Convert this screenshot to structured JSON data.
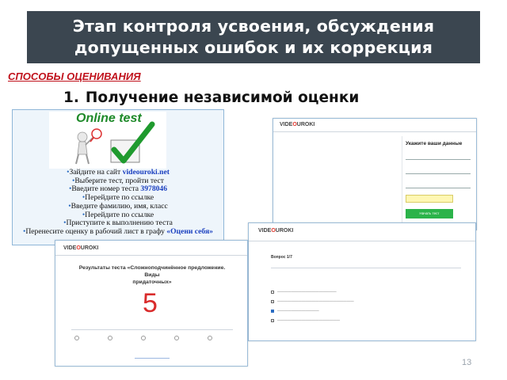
{
  "slide": {
    "title_line1": "Этап контроля усвоения, обсуждения",
    "title_line2": "допущенных ошибок  и их коррекция",
    "section_label": "СПОСОБЫ ОЦЕНИВАНИЯ",
    "list_number": "1.",
    "list_heading": "Получение независимой оценки",
    "page_number": "13"
  },
  "left_card": {
    "banner_text": "Online test",
    "steps": [
      {
        "text": "Зайдите на сайт ",
        "highlight": "videouroki.net"
      },
      {
        "text": "Выберите тест, пройти тест",
        "highlight": ""
      },
      {
        "text": "Введите номер теста ",
        "highlight": "3978046"
      },
      {
        "text": "Перейдите по ссылке",
        "highlight": ""
      },
      {
        "text": "Введите фамилию, имя, класс",
        "highlight": ""
      },
      {
        "text": "Перейдите по ссылке",
        "highlight": ""
      },
      {
        "text": "Приступите к выполнению теста",
        "highlight": ""
      },
      {
        "text": "Перенесите оценку в рабочий лист в графу ",
        "highlight": "«Оцени себя»"
      }
    ],
    "accent_color": "#1a3fbf"
  },
  "shot_form": {
    "logo_a": "VIDE",
    "logo_o": "O",
    "logo_b": "UROKI",
    "form_title": "Укажите ваши данные",
    "button_label": "Начать тест"
  },
  "shot_quiz": {
    "logo_a": "VIDE",
    "logo_o": "O",
    "logo_b": "UROKI",
    "question_title": "Вопрос 1/7"
  },
  "shot_result": {
    "logo_a": "VIDE",
    "logo_o": "O",
    "logo_b": "UROKI",
    "result_title_line1": "Результаты теста «Сложноподчинённое предложение. Виды",
    "result_title_line2": "придаточных»",
    "grade": "5"
  },
  "colors": {
    "title_bg": "#3b4650",
    "section_red": "#c0121c",
    "check_green": "#1f8a2a",
    "grade_red": "#d92b2b"
  }
}
